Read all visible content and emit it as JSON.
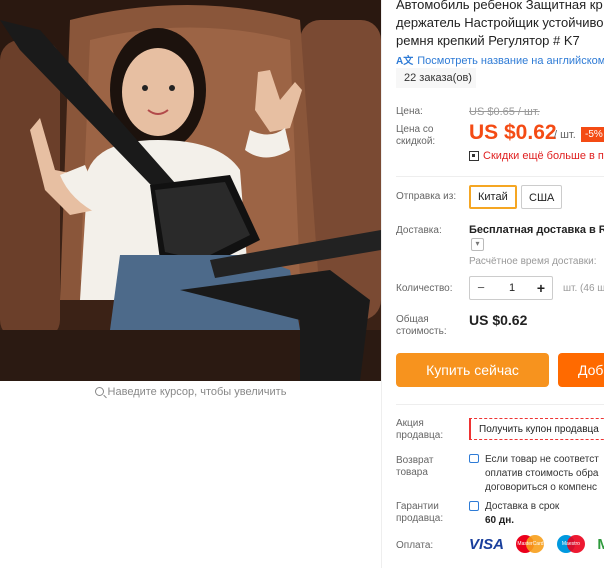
{
  "gallery": {
    "zoom_hint": "Наведите курсор, чтобы увеличить"
  },
  "product": {
    "title_lines": [
      "Автомобиль ребенок Защитная кр",
      "держатель Настройщик устойчиво",
      "ремня крепкий Регулятор # K7"
    ],
    "translate_link": "Посмотреть название на английском",
    "orders": "22 заказа(ов)"
  },
  "price": {
    "label": "Цена:",
    "old": "US $0.65 / шт.",
    "discount_label_1": "Цена со",
    "discount_label_2": "скидкой:",
    "current": "US $0.62",
    "unit": "/ шт.",
    "discount": "-5%",
    "promo": "Скидки ещё больше в пр"
  },
  "shipping": {
    "label": "Отправка из:",
    "options": [
      "Китай",
      "США"
    ],
    "selected": "Китай"
  },
  "delivery": {
    "label": "Доставка:",
    "value": "Бесплатная доставка в Ru",
    "time": "Расчётное время доставки:"
  },
  "quantity": {
    "label": "Количество:",
    "value": "1",
    "minus": "−",
    "plus": "+",
    "stock": "шт. (46 ш"
  },
  "total": {
    "label_1": "Общая",
    "label_2": "стоимость:",
    "value": "US $0.62"
  },
  "actions": {
    "buy_now": "Купить сейчас",
    "add_to_cart": "Доб"
  },
  "seller_promo": {
    "label_1": "Акция",
    "label_2": "продавца:",
    "coupon": "Получить купон продавца"
  },
  "returns": {
    "label_1": "Возврат",
    "label_2": "товара",
    "lines": [
      "Если товар не соответст",
      "оплатив стоимость обра",
      "договориться о компенс"
    ]
  },
  "guarantee": {
    "label_1": "Гарантии",
    "label_2": "продавца:",
    "line1": "Доставка в срок",
    "line2": "60 дн."
  },
  "payment": {
    "label": "Оплата:",
    "methods": [
      "VISA",
      "MasterCard",
      "Maestro",
      "MP"
    ]
  },
  "colors": {
    "accent": "#f44b14",
    "buy_button": "#f7931e",
    "cart_button": "#ff6a00",
    "link": "#2e7bd6"
  }
}
